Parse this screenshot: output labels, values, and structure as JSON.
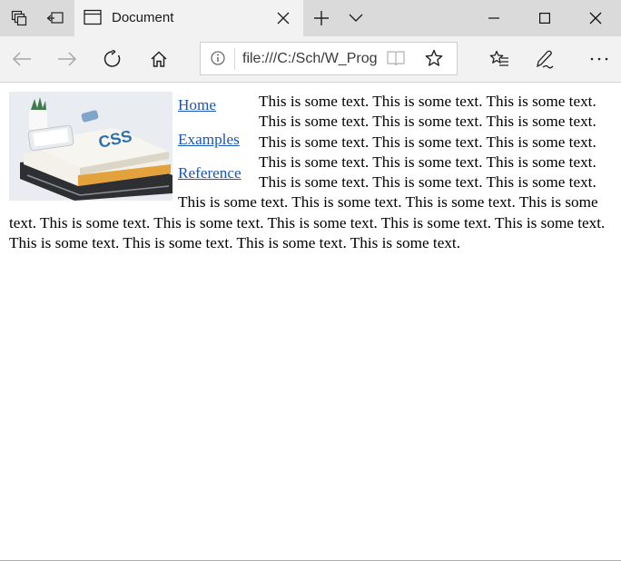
{
  "tabbar": {
    "tab_title": "Document",
    "icons": [
      "tab-set-aside-icon",
      "tab-preview-icon",
      "page-icon",
      "close-icon",
      "new-tab-plus-icon",
      "tab-list-chevron-icon"
    ],
    "window_controls": [
      "minimize-icon",
      "maximize-icon",
      "close-window-icon"
    ]
  },
  "navbar": {
    "url": "file:///C:/Sch/W_Prog",
    "icons": [
      "back-arrow-icon",
      "forward-arrow-icon",
      "refresh-icon",
      "home-icon",
      "info-icon",
      "reading-view-icon",
      "star-icon",
      "favorites-list-icon",
      "pen-icon",
      "more-icon"
    ]
  },
  "page": {
    "image_description_icon": "books-with-phone-image",
    "links": [
      "Home",
      "Examples",
      "Reference"
    ],
    "paragraph": "This is some text. This is some text. This is some text. This is some text. This is some text. This is some text. This is some text. This is some text. This is some text. This is some text. This is some text. This is some text. This is some text. This is some text. This is some text. This is some text. This is some text. This is some text. This is some text. This is some text. This is some text. This is some text. This is some text. This is some text. This is some text. This is some text. This is some text. This is some text."
  },
  "colors": {
    "tabbar_bg": "#dadada",
    "toolbar_bg": "#f2f2f2",
    "link": "#1a56b8"
  }
}
